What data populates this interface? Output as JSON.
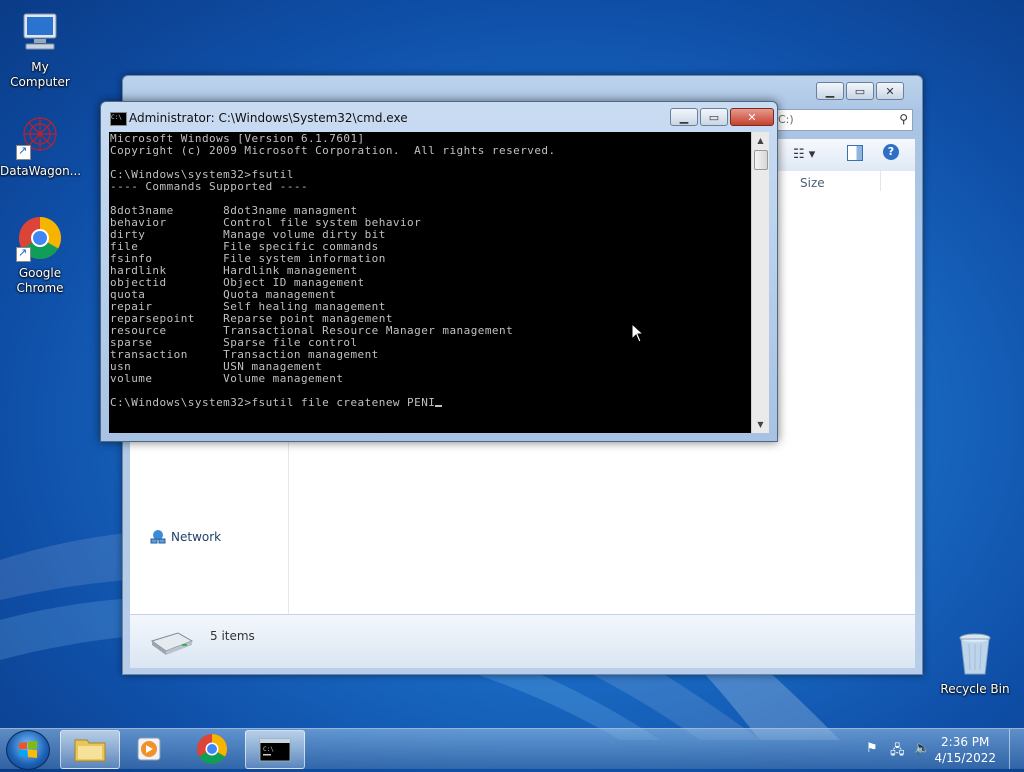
{
  "desktop": {
    "icons": [
      {
        "label": "My Computer"
      },
      {
        "label": "DataWagon..."
      },
      {
        "label": "Google Chrome"
      },
      {
        "label": "Recycle Bin"
      }
    ]
  },
  "explorer": {
    "search_placeholder": "C:)",
    "column_size": "Size",
    "nav_network": "Network",
    "status_items": "5 items"
  },
  "cmd": {
    "title": "Administrator: C:\\Windows\\System32\\cmd.exe",
    "lines": [
      "Microsoft Windows [Version 6.1.7601]",
      "Copyright (c) 2009 Microsoft Corporation.  All rights reserved.",
      "",
      "C:\\Windows\\system32>fsutil",
      "---- Commands Supported ----",
      "",
      "8dot3name       8dot3name managment",
      "behavior        Control file system behavior",
      "dirty           Manage volume dirty bit",
      "file            File specific commands",
      "fsinfo          File system information",
      "hardlink        Hardlink management",
      "objectid        Object ID management",
      "quota           Quota management",
      "repair          Self healing management",
      "reparsepoint    Reparse point management",
      "resource        Transactional Resource Manager management",
      "sparse          Sparse file control",
      "transaction     Transaction management",
      "usn             USN management",
      "volume          Volume management",
      ""
    ],
    "prompt_line": "C:\\Windows\\system32>fsutil file createnew PENI"
  },
  "taskbar": {
    "time": "2:36 PM",
    "date": "4/15/2022"
  }
}
